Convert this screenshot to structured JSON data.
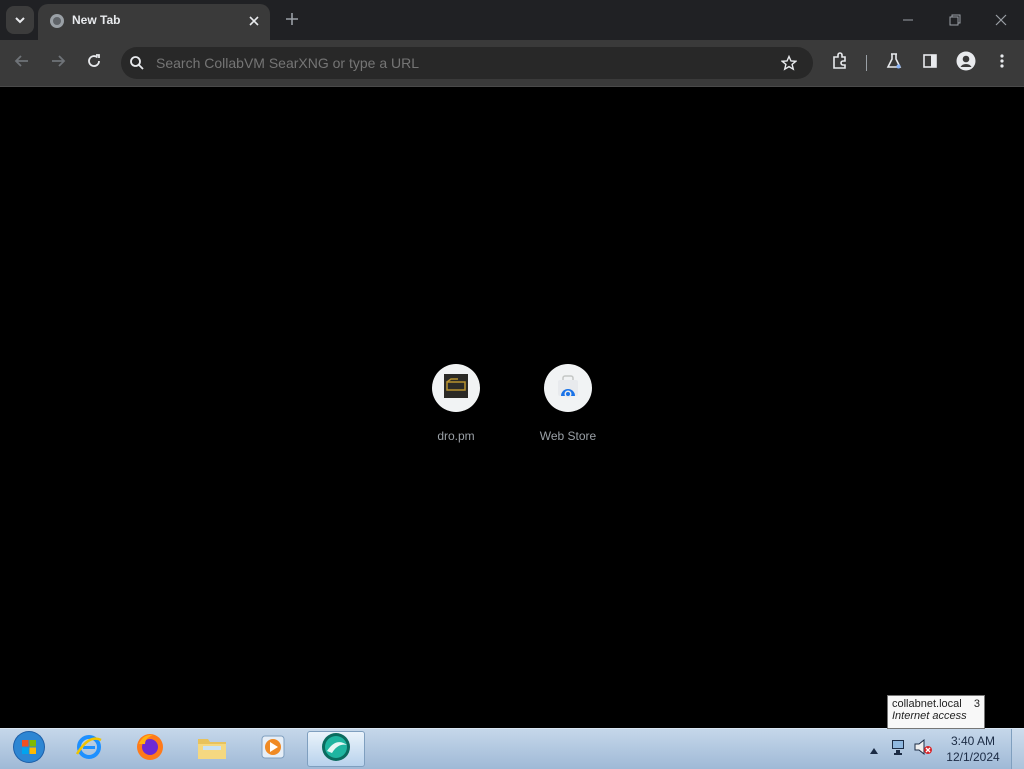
{
  "browser": {
    "tab": {
      "title": "New Tab"
    },
    "omnibox": {
      "placeholder": "Search CollabVM SearXNG or type a URL"
    },
    "icons": {
      "tab_search": "chevron-down-icon",
      "favicon": "globe-icon",
      "close": "close-icon",
      "new_tab": "plus-icon",
      "minimize": "minimize-icon",
      "restore": "restore-icon",
      "window_close": "close-icon",
      "back": "back-arrow-icon",
      "forward": "forward-arrow-icon",
      "reload": "reload-icon",
      "search": "search-icon",
      "bookmark": "star-icon",
      "extensions": "puzzle-icon",
      "labs": "flask-icon",
      "side_panel": "side-panel-icon",
      "profile": "profile-icon",
      "menu": "kebab-menu-icon"
    }
  },
  "shortcuts": [
    {
      "label": "dro.pm",
      "icon": "dro-pm-favicon"
    },
    {
      "label": "Web Store",
      "icon": "web-store-icon"
    }
  ],
  "taskbar": {
    "items": [
      {
        "name": "start-button",
        "icon": "windows-orb-icon"
      },
      {
        "name": "internet-explorer",
        "icon": "internet-explorer-icon"
      },
      {
        "name": "firefox",
        "icon": "firefox-icon"
      },
      {
        "name": "file-explorer",
        "icon": "folder-icon"
      },
      {
        "name": "media-player",
        "icon": "media-player-icon"
      },
      {
        "name": "browser",
        "icon": "browser-icon"
      }
    ],
    "clock": {
      "time": "3:40 AM",
      "date": "12/1/2024"
    }
  },
  "tooltip": {
    "network": "collabnet.local",
    "count": "3",
    "status": "Internet access"
  },
  "colors": {
    "tab_strip": "#202124",
    "toolbar": "#3a3a3a",
    "omnibox": "#282828",
    "content_bg": "#000000",
    "taskbar": "#b3c9e2"
  }
}
